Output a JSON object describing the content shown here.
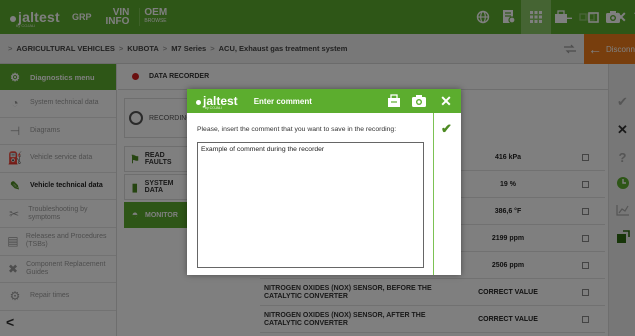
{
  "topbar": {
    "logo": "jaltest",
    "logo_sub": "by COJALI",
    "grp": "GRP",
    "vin": "VIN",
    "vin_sub": "INFO",
    "oem": "OEM",
    "oem_sub": "BROWSE",
    "icons": [
      "globe-icon",
      "document-icon",
      "list-icon",
      "clipboard-icon",
      "connector-icon",
      "camera-icon",
      "help-icon",
      "grid-icon"
    ],
    "window_buttons": [
      "minimize",
      "maximize",
      "close"
    ]
  },
  "breadcrumb": [
    "AGRICULTURAL VEHICLES",
    "KUBOTA",
    "M7 Series",
    "ACU, Exhaust gas treatment system"
  ],
  "disconnect_label": "Disconnect",
  "sidebar": {
    "header": "Diagnostics menu",
    "items": [
      {
        "label": "System technical data",
        "active": false
      },
      {
        "label": "Diagrams",
        "active": false
      },
      {
        "label": "Vehicle service data",
        "active": false
      },
      {
        "label": "Vehicle technical data",
        "active": true
      },
      {
        "label": "Troubleshooting by symptoms",
        "active": false
      },
      {
        "label": "Releases and Procedures (TSBs)",
        "active": false
      },
      {
        "label": "Component Replacement Guides",
        "active": false
      },
      {
        "label": "Repair times",
        "active": false
      }
    ]
  },
  "data_recorder": {
    "title": "DATA RECORDER",
    "recording_label": "RECORDING",
    "left_buttons": [
      "READ FAULTS",
      "SYSTEM DATA",
      "MONITOR"
    ],
    "rows": [
      {
        "name": "",
        "value": "416 kPa"
      },
      {
        "name": "",
        "value": "19 %"
      },
      {
        "name": "",
        "value": "386,6 °F"
      },
      {
        "name": "",
        "value": "2199 ppm"
      },
      {
        "name": "",
        "value": "2506 ppm"
      },
      {
        "name": "NITROGEN OXIDES (NOX) SENSOR, BEFORE THE CATALYTIC CONVERTER",
        "value": "CORRECT VALUE"
      },
      {
        "name": "NITROGEN OXIDES (NOX) SENSOR, AFTER THE CATALYTIC CONVERTER",
        "value": "CORRECT VALUE"
      }
    ]
  },
  "right_toolbar": [
    "check-icon",
    "close-icon",
    "help-icon",
    "clock-icon",
    "chart-icon",
    "export-icon"
  ],
  "modal": {
    "logo": "jaltest",
    "logo_sub": "by COJALI",
    "title": "Enter comment",
    "prompt": "Please, insert the comment that you want to save in the recording:",
    "comment": "Example of comment during the recorder"
  }
}
